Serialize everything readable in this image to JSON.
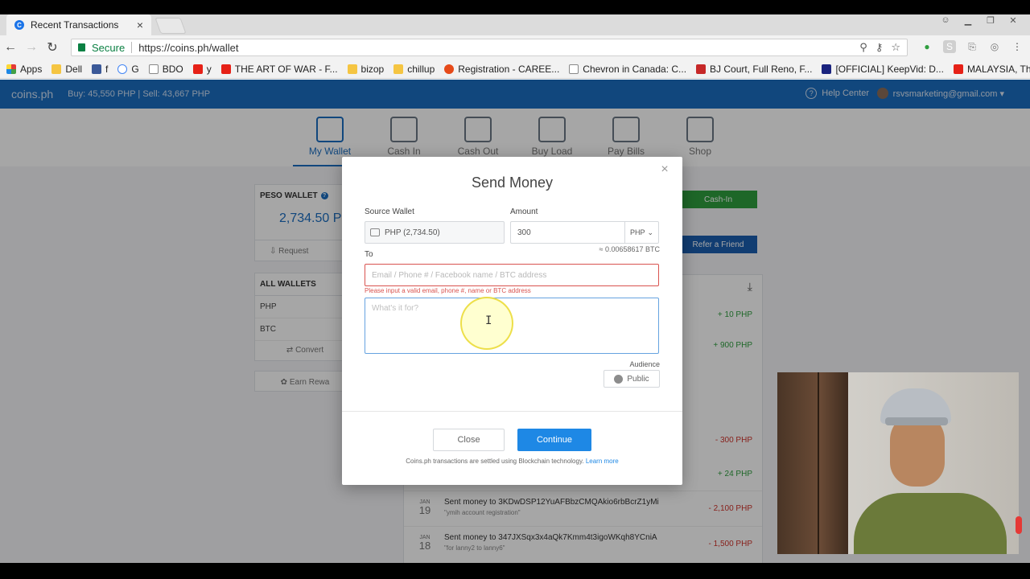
{
  "browser": {
    "tab_title": "Recent Transactions",
    "tab_close": "×",
    "secure_label": "Secure",
    "url": "https://coins.ph/wallet",
    "bookmarks": [
      {
        "label": "Apps",
        "icon": "apps"
      },
      {
        "label": "Dell",
        "icon": "folder"
      },
      {
        "label": "f",
        "icon": "fb"
      },
      {
        "label": "G",
        "icon": "g"
      },
      {
        "label": "BDO",
        "icon": "doc"
      },
      {
        "label": "y",
        "icon": "yt"
      },
      {
        "label": "THE ART OF WAR - F...",
        "icon": "yt"
      },
      {
        "label": "bizop",
        "icon": "folder"
      },
      {
        "label": "chillup",
        "icon": "folder"
      },
      {
        "label": "Registration - CAREE...",
        "icon": "reg"
      },
      {
        "label": "Chevron in Canada: C...",
        "icon": "doc"
      },
      {
        "label": "BJ Court, Full Reno, F...",
        "icon": "m"
      },
      {
        "label": "[OFFICIAL] KeepVid: D...",
        "icon": "kv"
      },
      {
        "label": "MALAYSIA, The Reser...",
        "icon": "yt"
      }
    ],
    "bookmarks_more": "»"
  },
  "site": {
    "logo": "coins.ph",
    "rates": "Buy: 45,550 PHP | Sell: 43,667 PHP",
    "help_center": "Help Center",
    "account_email": "rsvsmarketing@gmail.com ▾",
    "nav_tabs": [
      "My Wallet",
      "Cash In",
      "Cash Out",
      "Buy Load",
      "Pay Bills",
      "Shop"
    ],
    "peso_wallet_label": "PESO WALLET",
    "peso_balance": "2,734.50 P",
    "request_label": "Request",
    "all_wallets_label": "ALL WALLETS",
    "wallet_rows": [
      "PHP",
      "BTC"
    ],
    "convert_label": "Convert",
    "earn_label": "Earn Rewa",
    "cash_in_button": "Cash-In",
    "refer_button": "Refer a Friend",
    "tx_amounts_top": [
      "+ 10 PHP",
      "+ 900 PHP",
      "- 300 PHP",
      "+ 24 PHP"
    ],
    "transactions": [
      {
        "month": "JAN",
        "day": "19",
        "title": "Sent money to 3KDwDSP12YuAFBbzCMQAkio6rbBcrZ1yMi",
        "note": "\"ymih account registration\"",
        "amount": "- 2,100 PHP"
      },
      {
        "month": "JAN",
        "day": "18",
        "title": "Sent money to 347JXSqx3x4aQk7Kmm4t3igoWKqh8YCniA",
        "note": "\"for lanny2 to lanny6\"",
        "amount": "- 1,500 PHP"
      }
    ]
  },
  "modal": {
    "title": "Send Money",
    "close_x": "×",
    "source_wallet_label": "Source Wallet",
    "source_wallet_value": "PHP (2,734.50)",
    "amount_label": "Amount",
    "amount_value": "300",
    "currency": "PHP",
    "btc_conversion": "≈ 0.00658617 BTC",
    "to_label": "To",
    "to_placeholder": "Email / Phone # / Facebook name / BTC address",
    "to_error": "Please input a valid email, phone #, name or BTC address",
    "message_placeholder": "What's it for?",
    "audience_label": "Audience",
    "audience_value": "Public",
    "close_button": "Close",
    "continue_button": "Continue",
    "footnote": "Coins.ph transactions are settled using Blockchain technology.",
    "learn_more": "Learn more"
  },
  "colors": {
    "brand_blue": "#1b6dc1",
    "primary_button": "#1e88e5",
    "error_red": "#d9534f",
    "cash_in_green": "#2e9e3e"
  }
}
